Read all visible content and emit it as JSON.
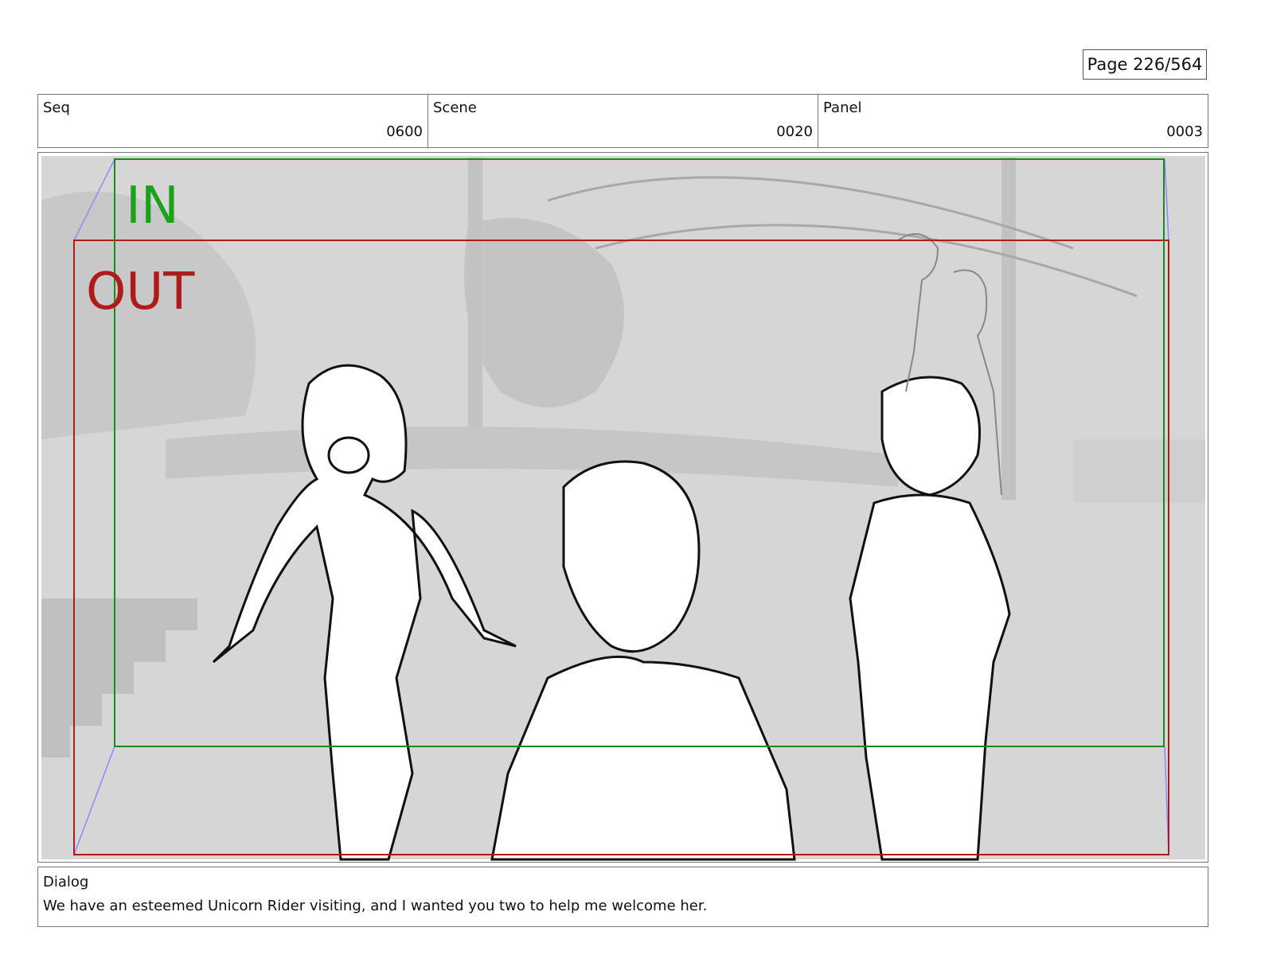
{
  "page": {
    "label": "Page 226/564"
  },
  "header": {
    "seq": {
      "label": "Seq",
      "value": "0600"
    },
    "scene": {
      "label": "Scene",
      "value": "0020"
    },
    "panel": {
      "label": "Panel",
      "value": "0003"
    }
  },
  "frame": {
    "in_label": "IN",
    "out_label": "OUT",
    "colors": {
      "in": "#1a8a1a",
      "out": "#b01a1a",
      "guide": "#8a8aff",
      "background": "#d4d4d4"
    }
  },
  "dialog": {
    "label": "Dialog",
    "text": "We have an esteemed Unicorn Rider visiting, and I wanted you two to help me welcome her."
  }
}
